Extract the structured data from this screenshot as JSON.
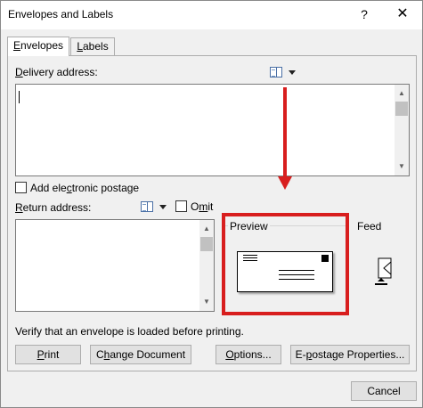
{
  "window": {
    "title": "Envelopes and Labels",
    "help": "?",
    "close": "✕"
  },
  "tabs": [
    {
      "label": "Envelopes",
      "mnemonic": "E",
      "rest": "nvelopes",
      "active": true
    },
    {
      "label": "Labels",
      "mnemonic": "L",
      "rest": "abels",
      "active": false
    }
  ],
  "delivery": {
    "label": "Delivery address:",
    "mnemonic": "D",
    "rest": "elivery address:",
    "value": ""
  },
  "postage": {
    "label": "Add electronic postage",
    "pre": "Add ele",
    "mnemonic": "c",
    "post": "tronic postage",
    "checked": false
  },
  "return": {
    "label": "Return address:",
    "mnemonic": "R",
    "rest": "eturn address:",
    "value": ""
  },
  "omit": {
    "label": "Omit",
    "pre": "O",
    "mnemonic": "m",
    "post": "it",
    "checked": false
  },
  "preview": {
    "label": "Preview"
  },
  "feed": {
    "label": "Feed"
  },
  "verify_text": "Verify that an envelope is loaded before printing.",
  "buttons": {
    "print": {
      "pre": "",
      "mnemonic": "P",
      "post": "rint"
    },
    "change": {
      "pre": "C",
      "mnemonic": "h",
      "post": "ange Document"
    },
    "options": {
      "pre": "",
      "mnemonic": "O",
      "post": "ptions..."
    },
    "epostage": {
      "pre": "E-",
      "mnemonic": "p",
      "post": "ostage Properties..."
    },
    "cancel": "Cancel"
  },
  "annotation_color": "#d81e1e",
  "icons": {
    "address_book": "address-book-icon",
    "dropdown": "chevron-down-icon",
    "feed": "envelope-feed-icon"
  }
}
